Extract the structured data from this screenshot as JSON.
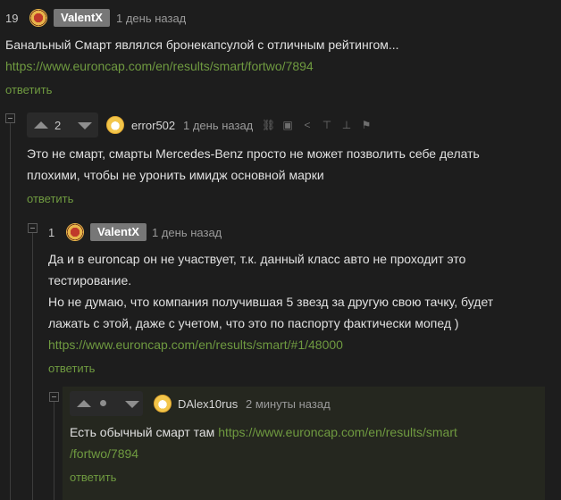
{
  "comments": [
    {
      "rating": "19",
      "author": "ValentX",
      "time": "1 день назад",
      "text_line1": "Банальный Смарт являлся бронекапсулой с отличным рейтингом...",
      "link": "https://www.euroncap.com/en/results/smart/fortwo/7894",
      "reply": "ответить"
    },
    {
      "rating": "2",
      "author": "error502",
      "time": "1 день назад",
      "text_line1": "Это не смарт, смарты Mercedes-Benz просто не может позволить себе делать",
      "text_line2": "плохими, чтобы не уронить имидж основной марки",
      "reply": "ответить",
      "tools": [
        "link-icon",
        "save-icon",
        "share-icon",
        "pin-icon",
        "user-icon",
        "flag-icon"
      ]
    },
    {
      "rating": "1",
      "author": "ValentX",
      "time": "1 день назад",
      "text_line1": "Да и в euroncap он не участвует, т.к. данный класс авто не проходит это",
      "text_line2": "тестирование.",
      "text_line3": "Но не думаю, что компания получившая 5 звезд за другую свою тачку, будет",
      "text_line4": "лажать с этой, даже с учетом, что это по паспорту фактически мопед )",
      "link": "https://www.euroncap.com/en/results/smart/#1/48000",
      "reply": "ответить"
    },
    {
      "author": "DAlex10rus",
      "time": "2 минуты назад",
      "text_prefix": "Есть обычный смарт там ",
      "link_part1": "https://www.euroncap.com/en/results/smart",
      "link_part2": "/fortwo/7894",
      "reply": "ответить"
    }
  ]
}
